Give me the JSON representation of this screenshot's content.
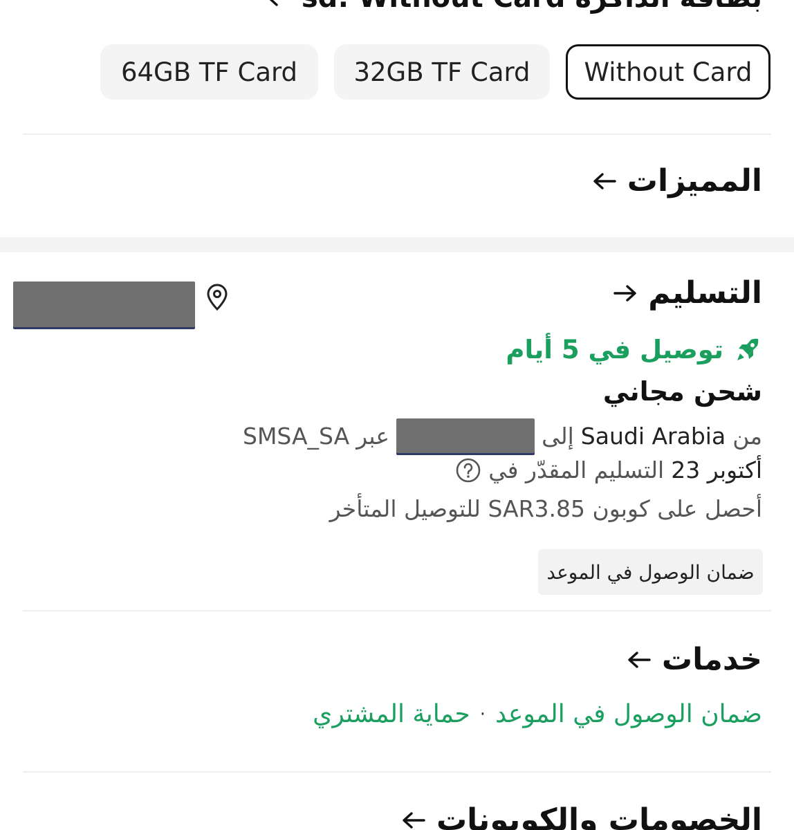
{
  "sd_header": {
    "text": "بطاقة الذاكرة sd: Without Card"
  },
  "sd_options": [
    {
      "label": "64GB TF Card",
      "selected": false
    },
    {
      "label": "32GB TF Card",
      "selected": false
    },
    {
      "label": "Without Card",
      "selected": true
    }
  ],
  "features": {
    "title": "المميزات"
  },
  "delivery": {
    "title": "التسليم",
    "fast_label": "توصيل في 5 أيام",
    "free_shipping": "شحن مجاني",
    "from_word": "من",
    "origin": "Saudi Arabia",
    "to_word": "إلى",
    "via_word": "عبر",
    "carrier": "SMSA_SA",
    "eta_date": "أكتوبر 23",
    "eta_label": "التسليم المقدّر في",
    "coupon_text": "أحصل على كوبون SAR3.85 للتوصيل المتأخر",
    "guarantee_badge": "ضمان الوصول في الموعد"
  },
  "services": {
    "title": "خدمات",
    "item1": "ضمان الوصول في الموعد",
    "separator": "·",
    "item2": "حماية المشتري"
  },
  "discounts": {
    "title": "الخصومات والكوبونات"
  },
  "colors": {
    "green": "#1a9f5f",
    "text": "#111111",
    "muted": "#555555",
    "chip_bg": "#f4f4f4"
  },
  "icons": [
    "arrow-left-icon",
    "arrow-right-icon",
    "location-pin-icon",
    "rocket-icon",
    "help-circle-icon"
  ]
}
